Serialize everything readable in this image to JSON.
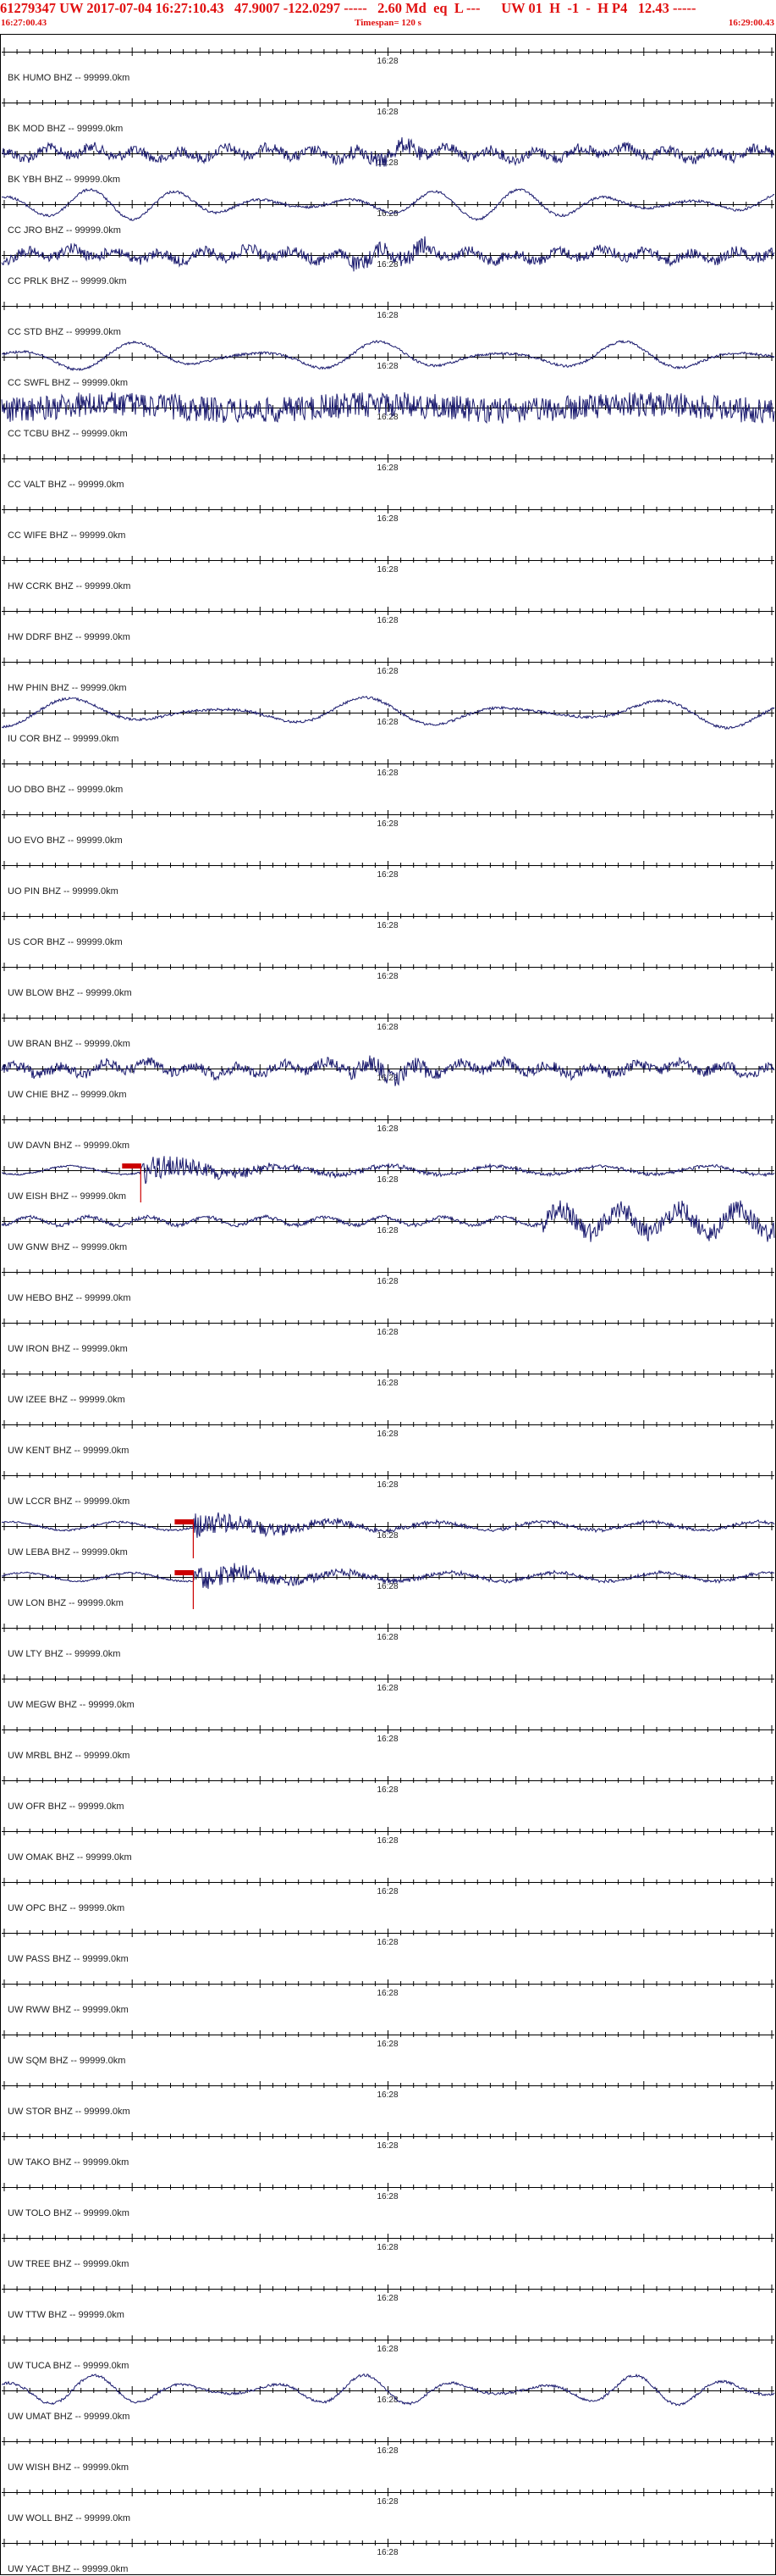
{
  "header": {
    "title": "61279347 UW 2017-07-04 16:27:10.43   47.9007 -122.0297 -----   2.60 Md  eq  L ---      UW 01  H  -1  -  H P4   12.43 -----",
    "start_time": "16:27:00.43",
    "timespan": "Timespan= 120 s",
    "end_time": "16:29:00.43"
  },
  "colors": {
    "header_text": "#e01010",
    "trace": "#1a1a6e",
    "axis": "#000000",
    "label_text": "#222222",
    "pick_marker": "#cc0000"
  },
  "chart_data": {
    "type": "line",
    "title": "61279347 UW 2017-07-04 16:27:10.43   47.9007 -122.0297 -----   2.60 Md  eq  L ---      UW 01  H  -1  -  H P4   12.43 -----",
    "xlabel": "",
    "ylabel": "",
    "x_start": "16:27:00.43",
    "x_end": "16:29:00.43",
    "timespan_s": 120,
    "center_tick_label": "16:28",
    "grid": false,
    "rows": [
      {
        "label": "BK HUMO BHZ -- 99999.0km",
        "activity": "none"
      },
      {
        "label": "BK MOD BHZ -- 99999.0km",
        "activity": "none"
      },
      {
        "label": "BK YBH BHZ -- 99999.0km",
        "activity": "noise"
      },
      {
        "label": "CC JRO BHZ -- 99999.0km",
        "activity": "wave"
      },
      {
        "label": "CC PRLK BHZ -- 99999.0km",
        "activity": "noise"
      },
      {
        "label": "CC STD BHZ -- 99999.0km",
        "activity": "none"
      },
      {
        "label": "CC SWFL BHZ -- 99999.0km",
        "activity": "wave"
      },
      {
        "label": "CC TCBU BHZ -- 99999.0km",
        "activity": "dense"
      },
      {
        "label": "CC VALT BHZ -- 99999.0km",
        "activity": "none"
      },
      {
        "label": "CC WIFE BHZ -- 99999.0km",
        "activity": "none"
      },
      {
        "label": "HW CCRK BHZ -- 99999.0km",
        "activity": "none"
      },
      {
        "label": "HW DDRF BHZ -- 99999.0km",
        "activity": "none"
      },
      {
        "label": "HW PHIN BHZ -- 99999.0km",
        "activity": "none"
      },
      {
        "label": "IU COR BHZ -- 99999.0km",
        "activity": "wave"
      },
      {
        "label": "UO DBO BHZ -- 99999.0km",
        "activity": "none"
      },
      {
        "label": "UO EVO BHZ -- 99999.0km",
        "activity": "none"
      },
      {
        "label": "UO PIN BHZ -- 99999.0km",
        "activity": "none"
      },
      {
        "label": "US COR BHZ -- 99999.0km",
        "activity": "none"
      },
      {
        "label": "UW BLOW BHZ -- 99999.0km",
        "activity": "none"
      },
      {
        "label": "UW BRAN BHZ -- 99999.0km",
        "activity": "none"
      },
      {
        "label": "UW CHIE BHZ -- 99999.0km",
        "activity": "noise"
      },
      {
        "label": "UW DAVN BHZ -- 99999.0km",
        "activity": "none"
      },
      {
        "label": "UW EISH BHZ -- 99999.0km",
        "activity": "event",
        "pick": 0.18
      },
      {
        "label": "UW GNW BHZ -- 99999.0km",
        "activity": "noise_late"
      },
      {
        "label": "UW HEBO BHZ -- 99999.0km",
        "activity": "none"
      },
      {
        "label": "UW IRON BHZ -- 99999.0km",
        "activity": "none"
      },
      {
        "label": "UW IZEE BHZ -- 99999.0km",
        "activity": "none"
      },
      {
        "label": "UW KENT BHZ -- 99999.0km",
        "activity": "none"
      },
      {
        "label": "UW LCCR BHZ -- 99999.0km",
        "activity": "none"
      },
      {
        "label": "UW LEBA BHZ -- 99999.0km",
        "activity": "event",
        "pick": 0.248
      },
      {
        "label": "UW LON BHZ -- 99999.0km",
        "activity": "event",
        "pick": 0.248
      },
      {
        "label": "UW LTY BHZ -- 99999.0km",
        "activity": "none"
      },
      {
        "label": "UW MEGW BHZ -- 99999.0km",
        "activity": "none"
      },
      {
        "label": "UW MRBL BHZ -- 99999.0km",
        "activity": "none"
      },
      {
        "label": "UW OFR BHZ -- 99999.0km",
        "activity": "none"
      },
      {
        "label": "UW OMAK BHZ -- 99999.0km",
        "activity": "none"
      },
      {
        "label": "UW OPC BHZ -- 99999.0km",
        "activity": "none"
      },
      {
        "label": "UW PASS BHZ -- 99999.0km",
        "activity": "none"
      },
      {
        "label": "UW RWW BHZ -- 99999.0km",
        "activity": "none"
      },
      {
        "label": "UW SQM BHZ -- 99999.0km",
        "activity": "none"
      },
      {
        "label": "UW STOR BHZ -- 99999.0km",
        "activity": "none"
      },
      {
        "label": "UW TAKO BHZ -- 99999.0km",
        "activity": "none"
      },
      {
        "label": "UW TOLO BHZ -- 99999.0km",
        "activity": "none"
      },
      {
        "label": "UW TREE BHZ -- 99999.0km",
        "activity": "none"
      },
      {
        "label": "UW TTW BHZ -- 99999.0km",
        "activity": "none"
      },
      {
        "label": "UW TUCA BHZ -- 99999.0km",
        "activity": "none"
      },
      {
        "label": "UW UMAT BHZ -- 99999.0km",
        "activity": "wave"
      },
      {
        "label": "UW WISH BHZ -- 99999.0km",
        "activity": "none"
      },
      {
        "label": "UW WOLL BHZ -- 99999.0km",
        "activity": "none"
      },
      {
        "label": "UW YACT BHZ -- 99999.0km",
        "activity": "none"
      }
    ]
  }
}
